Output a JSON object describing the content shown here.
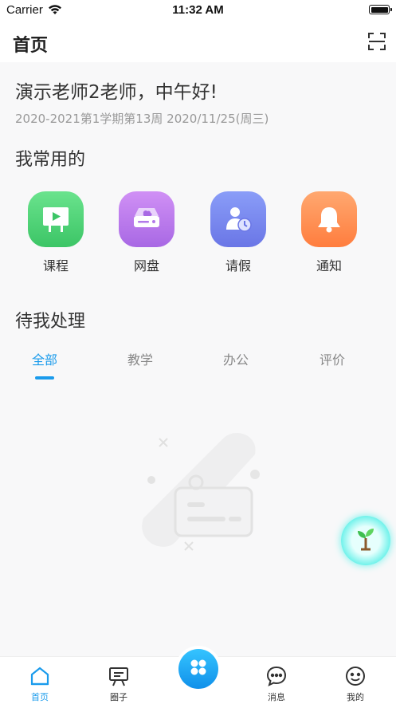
{
  "status_bar": {
    "carrier": "Carrier",
    "time": "11:32 AM"
  },
  "nav": {
    "title": "首页",
    "scan_icon": "scan-icon"
  },
  "greeting": "演示老师2老师，中午好!",
  "term_info": "2020-2021第1学期第13周 2020/11/25(周三)",
  "frequent": {
    "title": "我常用的",
    "items": [
      {
        "label": "课程",
        "icon": "course-icon",
        "color": "#4fd37a"
      },
      {
        "label": "网盘",
        "icon": "cloud-disk-icon",
        "color": "#b879ec"
      },
      {
        "label": "请假",
        "icon": "leave-icon",
        "color": "#7a8cf2"
      },
      {
        "label": "通知",
        "icon": "bell-icon",
        "color": "#ff9050"
      }
    ]
  },
  "pending": {
    "title": "待我处理",
    "tabs": [
      "全部",
      "教学",
      "办公",
      "评价"
    ],
    "active_tab": 0
  },
  "tabbar": {
    "items": [
      {
        "label": "首页",
        "icon": "home-icon"
      },
      {
        "label": "圈子",
        "icon": "board-icon"
      },
      {
        "label": "消息",
        "icon": "message-icon"
      },
      {
        "label": "我的",
        "icon": "smile-icon"
      }
    ],
    "active": 0
  },
  "colors": {
    "accent": "#1a9bec"
  }
}
